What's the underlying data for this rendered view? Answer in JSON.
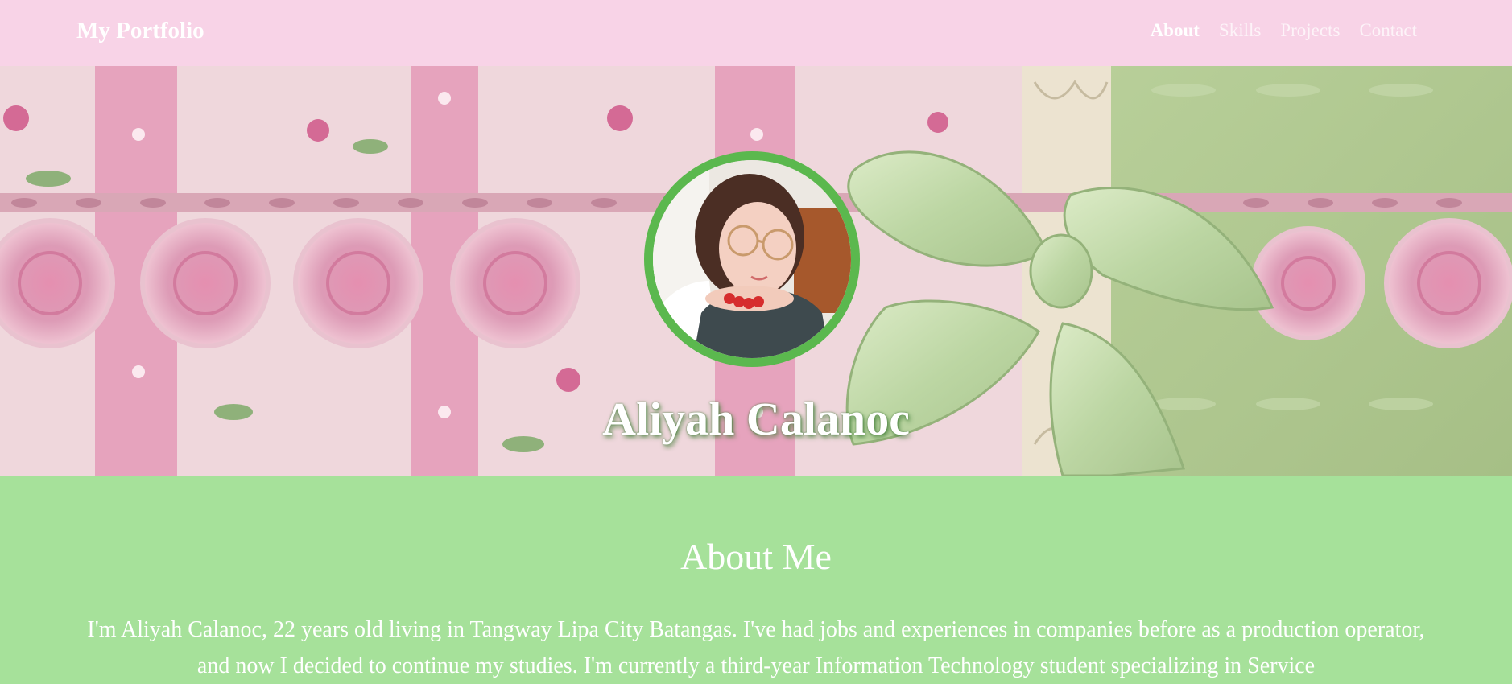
{
  "navbar": {
    "brand": "My Portfolio",
    "links": [
      {
        "label": "About",
        "active": true
      },
      {
        "label": "Skills",
        "active": false
      },
      {
        "label": "Projects",
        "active": false
      },
      {
        "label": "Contact",
        "active": false
      }
    ]
  },
  "hero": {
    "name": "Aliyah Calanoc",
    "avatar_icon": "profile-photo"
  },
  "about": {
    "title": "About Me",
    "text": "I'm Aliyah Calanoc, 22 years old living in Tangway Lipa City Batangas. I've had jobs and experiences in companies before as a production operator, and now I decided to continue my studies. I'm currently a third-year Information Technology student specializing in Service"
  },
  "colors": {
    "navbar_bg": "#f8d3e7",
    "about_bg": "#a6e19a",
    "avatar_ring": "#5bb84e",
    "text": "#ffffff"
  }
}
